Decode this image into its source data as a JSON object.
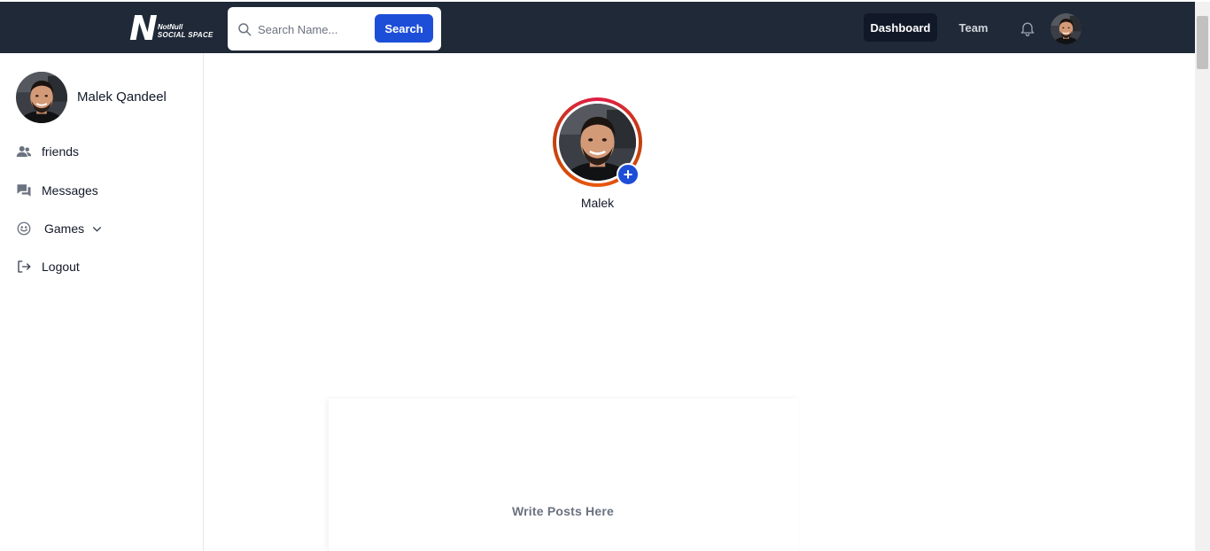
{
  "brand": {
    "mark": "N",
    "line1": "NotNull",
    "line2": "SOCIAL SPACE"
  },
  "search": {
    "placeholder": "Search Name...",
    "button_label": "Search"
  },
  "nav": {
    "dashboard": "Dashboard",
    "team": "Team"
  },
  "user": {
    "name": "Malek Qandeel"
  },
  "sidebar": {
    "items": [
      {
        "label": "friends",
        "icon": "users-icon"
      },
      {
        "label": "Messages",
        "icon": "chat-icon"
      },
      {
        "label": "Games",
        "icon": "smile-icon"
      },
      {
        "label": "Logout",
        "icon": "logout-icon"
      }
    ]
  },
  "story": {
    "name": "Malek",
    "add_symbol": "+"
  },
  "post": {
    "placeholder": "Write Posts Here"
  },
  "colors": {
    "topbar": "#1f2937",
    "accent": "#1d4ed8"
  }
}
